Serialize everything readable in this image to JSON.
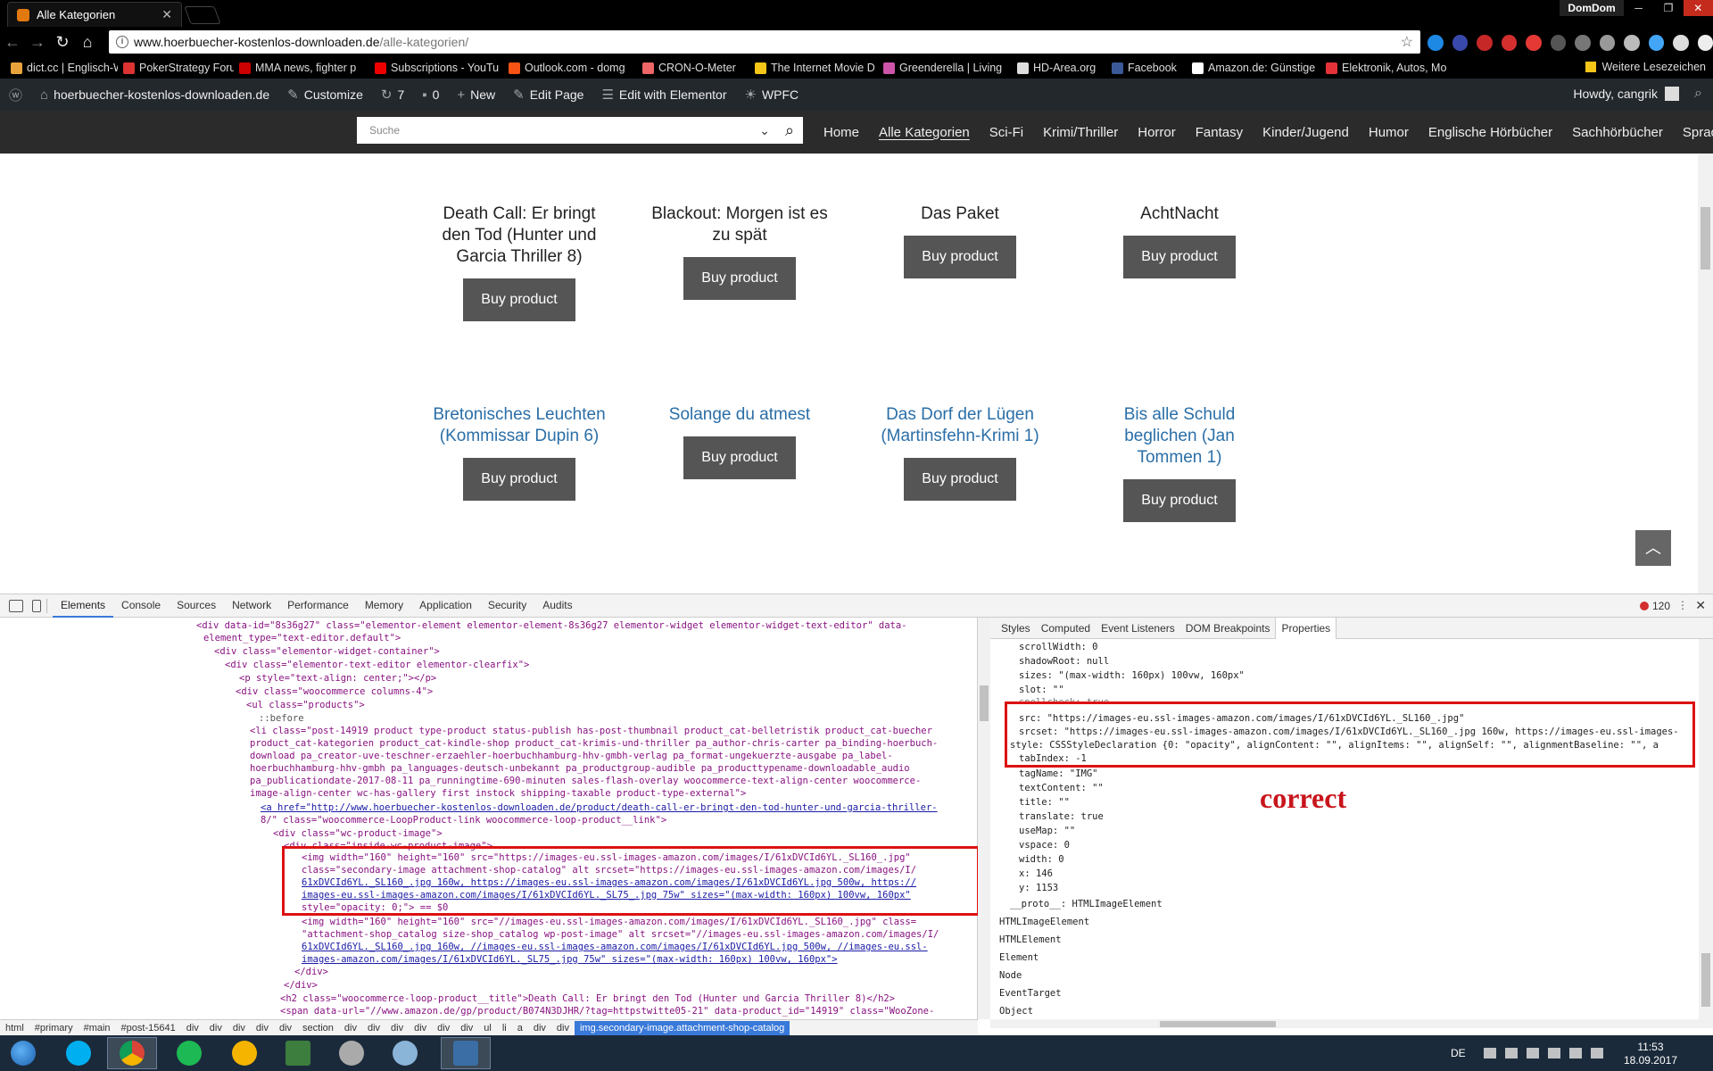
{
  "browser": {
    "tab_title": "Alle Kategorien",
    "profile": "DomDom",
    "url_host": "www.hoerbuecher-kostenlos-downloaden.de",
    "url_path": "/alle-kategorien/"
  },
  "bookmarks": {
    "items": [
      {
        "label": "dict.cc | Englisch-Wö",
        "color": "#e8a33c"
      },
      {
        "label": "PokerStrategy Forum",
        "color": "#d33"
      },
      {
        "label": "MMA news, fighter p",
        "color": "#c00"
      },
      {
        "label": "Subscriptions - YouTu",
        "color": "#e00"
      },
      {
        "label": "Outlook.com - domg",
        "color": "#f65314"
      },
      {
        "label": "CRON-O-Meter",
        "color": "#e66"
      },
      {
        "label": "The Internet Movie D",
        "color": "#f5c518"
      },
      {
        "label": "Greenderella | Living",
        "color": "#c5a"
      },
      {
        "label": "HD-Area.org",
        "color": "#ddd"
      },
      {
        "label": "Facebook",
        "color": "#3b5998"
      },
      {
        "label": "Amazon.de: Günstige",
        "color": "#fff"
      },
      {
        "label": "Elektronik, Autos, Mo",
        "color": "#e53238"
      }
    ],
    "more": "Weitere Lesezeichen"
  },
  "wpbar": {
    "site": "hoerbuecher-kostenlos-downloaden.de",
    "customize": "Customize",
    "updates": "7",
    "comments": "0",
    "new": "New",
    "edit_page": "Edit Page",
    "elementor": "Edit with Elementor",
    "wpfc": "WPFC",
    "howdy": "Howdy, cangrik"
  },
  "site": {
    "search_placeholder": "Suche",
    "menu": [
      "Home",
      "Alle Kategorien",
      "Sci-Fi",
      "Krimi/Thriller",
      "Horror",
      "Fantasy",
      "Kinder/Jugend",
      "Humor",
      "Englische Hörbücher",
      "Sachhörbücher",
      "Sprachkurse"
    ],
    "buy_label": "Buy product",
    "products_row1": [
      {
        "line1": "Death Call: Er bringt",
        "line2": "den Tod (Hunter und",
        "line3": "Garcia Thriller 8)"
      },
      {
        "line1": "Blackout: Morgen ist es",
        "line2": "zu spät",
        "line3": ""
      },
      {
        "line1": "Das Paket",
        "line2": "",
        "line3": ""
      },
      {
        "line1": "AchtNacht",
        "line2": "",
        "line3": ""
      }
    ],
    "products_row2": [
      {
        "line1": "Bretonisches Leuchten",
        "line2": "(Kommissar Dupin 6)",
        "line3": ""
      },
      {
        "line1": "Solange du atmest",
        "line2": "",
        "line3": ""
      },
      {
        "line1": "Das Dorf der Lügen",
        "line2": "(Martinsfehn-Krimi 1)",
        "line3": ""
      },
      {
        "line1": "Bis alle Schuld",
        "line2": "beglichen (Jan",
        "line3": "Tommen 1)"
      }
    ]
  },
  "devtools": {
    "tabs": [
      "Elements",
      "Console",
      "Sources",
      "Network",
      "Performance",
      "Memory",
      "Application",
      "Security",
      "Audits"
    ],
    "error_count": "120",
    "side_tabs": [
      "Styles",
      "Computed",
      "Event Listeners",
      "DOM Breakpoints",
      "Properties"
    ],
    "dom_lines": [
      "<div data-id=\"8s36g27\" class=\"elementor-element elementor-element-8s36g27 elementor-widget elementor-widget-text-editor\" data-",
      "element_type=\"text-editor.default\">",
      "<div class=\"elementor-widget-container\">",
      "<div class=\"elementor-text-editor elementor-clearfix\">",
      "<p style=\"text-align: center;\"></p>",
      "<div class=\"woocommerce columns-4\">",
      "<ul class=\"products\">",
      "::before",
      "<li class=\"post-14919 product type-product status-publish has-post-thumbnail product_cat-belletristik product_cat-buecher",
      "product_cat-kategorien product_cat-kindle-shop product_cat-krimis-und-thriller pa_author-chris-carter pa_binding-hoerbuch-",
      "download pa_creator-uve-teschner-erzaehler-hoerbuchhamburg-hhv-gmbh-verlag pa_format-ungekuerzte-ausgabe pa_label-",
      "hoerbuchhamburg-hhv-gmbh pa_languages-deutsch-unbekannt pa_productgroup-audible pa_producttypename-downloadable_audio",
      "pa_publicationdate-2017-08-11 pa_runningtime-690-minuten sales-flash-overlay woocommerce-text-align-center woocommerce-",
      "image-align-center wc-has-gallery first instock shipping-taxable product-type-external\">",
      "<a href=\"http://www.hoerbuecher-kostenlos-downloaden.de/product/death-call-er-bringt-den-tod-hunter-und-garcia-thriller-",
      "8/\" class=\"woocommerce-LoopProduct-link woocommerce-loop-product__link\">",
      "<div class=\"wc-product-image\">",
      "<div class=\"inside-wc-product-image\">",
      "<img width=\"160\" height=\"160\" src=\"https://images-eu.ssl-images-amazon.com/images/I/61xDVCId6YL._SL160_.jpg\"",
      "class=\"secondary-image attachment-shop-catalog\" alt srcset=\"https://images-eu.ssl-images-amazon.com/images/I/",
      "61xDVCId6YL._SL160_.jpg 160w, https://images-eu.ssl-images-amazon.com/images/I/61xDVCId6YL.jpg 500w, https://",
      "images-eu.ssl-images-amazon.com/images/I/61xDVCId6YL._SL75_.jpg 75w\" sizes=\"(max-width: 160px) 100vw, 160px\"",
      "style=\"opacity: 0;\"> == $0",
      "<img width=\"160\" height=\"160\" src=\"//images-eu.ssl-images-amazon.com/images/I/61xDVCId6YL._SL160_.jpg\" class=",
      "\"attachment-shop_catalog size-shop_catalog wp-post-image\" alt srcset=\"//images-eu.ssl-images-amazon.com/images/I/",
      "61xDVCId6YL._SL160_.jpg 160w, //images-eu.ssl-images-amazon.com/images/I/61xDVCId6YL.jpg 500w, //images-eu.ssl-",
      "images-amazon.com/images/I/61xDVCId6YL._SL75_.jpg 75w\" sizes=\"(max-width: 160px) 100vw, 160px\">",
      "</div>",
      "</div>",
      "<h2 class=\"woocommerce-loop-product__title\">Death Call: Er bringt den Tod (Hunter und Garcia Thriller 8)</h2>",
      "<span data-url=\"//www.amazon.de/gp/product/B074N3DJHR/?tag=httpstwitte05-21\" data-product_id=\"14919\" class=\"WooZone-"
    ],
    "props_lines": [
      "scrollWidth: 0",
      "shadowRoot: null",
      "sizes: \"(max-width: 160px) 100vw, 160px\"",
      "slot: \"\"",
      "spellcheck: true",
      "src: \"https://images-eu.ssl-images-amazon.com/images/I/61xDVCId6YL._SL160_.jpg\"",
      "srcset: \"https://images-eu.ssl-images-amazon.com/images/I/61xDVCId6YL._SL160_.jpg 160w, https://images-eu.ssl-images-",
      "style: CSSStyleDeclaration {0: \"opacity\", alignContent: \"\", alignItems: \"\", alignSelf: \"\", alignmentBaseline: \"\", a",
      "tabIndex: -1",
      "tagName: \"IMG\"",
      "textContent: \"\"",
      "title: \"\"",
      "translate: true",
      "useMap: \"\"",
      "vspace: 0",
      "width: 0",
      "x: 146",
      "y: 1153",
      "__proto__: HTMLImageElement",
      "HTMLImageElement",
      "HTMLElement",
      "Element",
      "Node",
      "EventTarget",
      "Object"
    ],
    "annotation": "correct",
    "breadcrumbs": [
      "html",
      "#primary",
      "#main",
      "#post-15641",
      "div",
      "div",
      "div",
      "div",
      "div",
      "section",
      "div",
      "div",
      "div",
      "div",
      "div",
      "div",
      "ul",
      "li",
      "a",
      "div",
      "div",
      "img.secondary-image.attachment-shop-catalog"
    ]
  },
  "taskbar": {
    "lang": "DE",
    "time": "11:53",
    "date": "18.09.2017"
  }
}
